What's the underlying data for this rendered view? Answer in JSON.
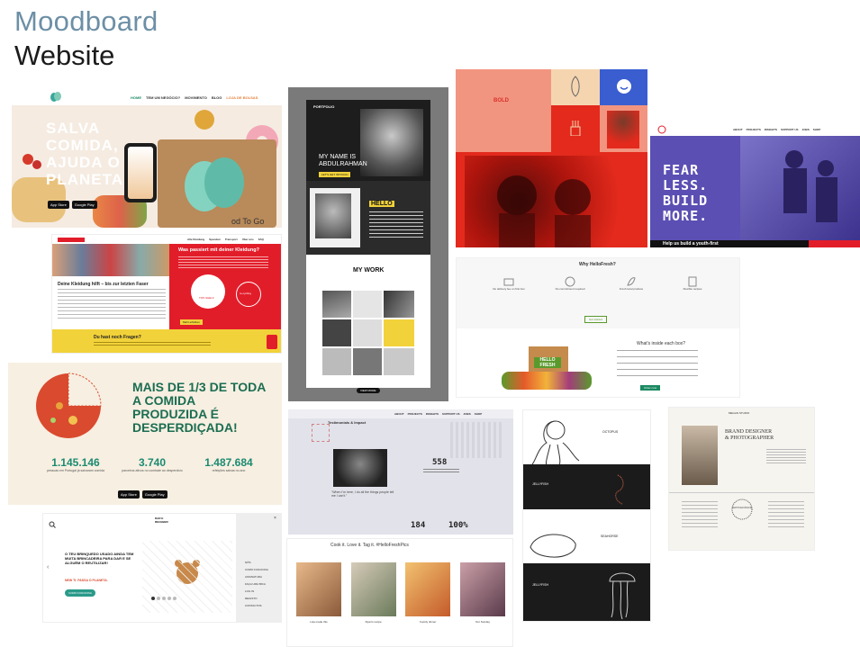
{
  "header": {
    "title": "Moodboard",
    "subtitle": "Website"
  },
  "tiles": {
    "too_good": {
      "nav": [
        "HOME",
        "TEM UM NEGÓCIO?",
        "MOVIMENTO",
        "BLOG",
        "LOJA DE BOLSAS"
      ],
      "headline": "SALVA COMIDA, AJUDA O PLANETA",
      "bag_text": "od To Go",
      "badges": [
        "App Store",
        "Google Play"
      ]
    },
    "portfolio_dark": {
      "brand": "PORTFOLIO",
      "heading": "MY NAME IS ABDULRAHMAN",
      "cta": "LET'S GET INTOUCH",
      "hello": "HELLO",
      "work": "MY WORK",
      "more": "VIEW MORE"
    },
    "bold_red": {
      "label": "BOLD"
    },
    "fearless": {
      "nav": [
        "ABOUT",
        "PROJECTS",
        "INSIGHTS",
        "SUPPORT US",
        "JOBS",
        "SHOP"
      ],
      "headline": "FEAR LESS. BUILD MORE.",
      "sub": "Help us build a youth-first"
    },
    "kleidung": {
      "headline": "Was passiert mit deiner Kleidung?",
      "sub": "Deine Kleidung hilft – bis zur letzten Faser",
      "circle1": "TOP-SHELF",
      "circle2": "re-cycling",
      "button": "Mehr erfahren",
      "faq": "Du hast noch Fragen?",
      "nav": [
        "Alle Kleidung",
        "Spenden",
        "Transport",
        "Über uns",
        "FAQ"
      ]
    },
    "hellofresh": {
      "top_title": "Why HelloFresh?",
      "features": [
        "No delivery fee on first box",
        "No commitment required",
        "Fresh local produce",
        "Flexible recipes"
      ],
      "btn1": "Get started",
      "box_title": "What's inside each box?",
      "box_label": "HELLO FRESH",
      "btn2": "Order now",
      "hashtag": "Cook it. Love it. Tag it. #HelloFreshPics",
      "captions": [
        "Lisa made this",
        "Ryan's recipe",
        "Family dinner",
        "Our Sunday"
      ]
    },
    "food_waste": {
      "headline": "MAIS DE 1/3 DE TODA A COMIDA PRODUZIDA É DESPERDIÇADA!",
      "stats": [
        {
          "value": "1.145.146",
          "label": "pessoas em Portugal já salvaram comida"
        },
        {
          "value": "3.740",
          "label": "parceiros ativos no combate ao desperdício"
        },
        {
          "value": "1.487.684",
          "label": "refeições salvas no ano"
        }
      ],
      "badges": [
        "App Store",
        "Google Play"
      ]
    },
    "testimonials": {
      "nav": [
        "ABOUT",
        "PROJECTS",
        "INSIGHTS",
        "SUPPORT US",
        "JOBS",
        "SHOP"
      ],
      "title": "Testimonials & Impact",
      "big_number": "558",
      "stat_a": "184",
      "stat_b": "100%",
      "quote": "\"When I'm here, I do all the things people tell me I can't.\""
    },
    "octopus": {
      "heading1": "OCTOPUS",
      "heading2": "JELLYFISH",
      "heading3": "SEAHORSE"
    },
    "brand_designer": {
      "brand": "MEGAN STUDIO",
      "headline": "BRAND DESIGNER & PHOTOGRAPHER",
      "seal": "CERTIFIED BRAND"
    },
    "toy": {
      "logo": "DAR E RECEBER",
      "headline": "O TEU BRINQUEDO USADO AINDA TEM MUITA BRINCADEIRA PARA DAR E SE ALGUÉM O REUTILIZAR!",
      "sub": "NEW TI. PASSA O PLANETA.",
      "cta": "COMO FUNCIONA",
      "menu": [
        "NÓS",
        "COMO FUNCIONA",
        "ASSINATURA",
        "FAÇA UMA BICA",
        "LOG IN",
        "REGISTO",
        "CONTACTOS"
      ]
    }
  },
  "colors": {
    "title_blue": "#6d8fa6",
    "green": "#1b8a62",
    "red": "#e21d2a",
    "yellow": "#f2d23a",
    "salmon": "#f29580",
    "purple": "#5b4fb3"
  }
}
